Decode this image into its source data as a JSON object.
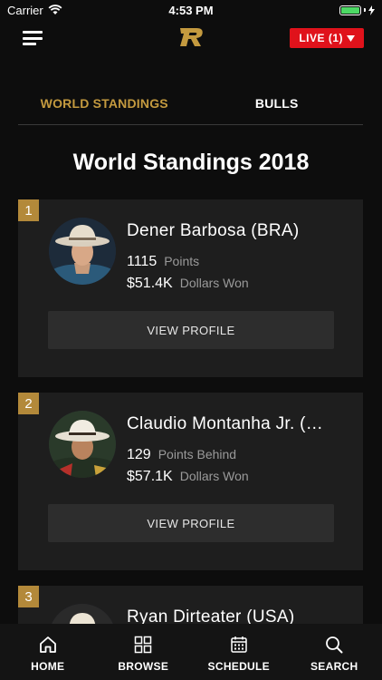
{
  "status_bar": {
    "carrier": "Carrier",
    "time": "4:53 PM"
  },
  "header": {
    "live_label": "LIVE (1)"
  },
  "tabs": [
    {
      "label": "WORLD STANDINGS",
      "active": true
    },
    {
      "label": "BULLS",
      "active": false
    }
  ],
  "section_title": "World Standings 2018",
  "riders": [
    {
      "rank": "1",
      "name": "Dener Barbosa (BRA)",
      "stat1_value": "1115",
      "stat1_label": "Points",
      "stat2_value": "$51.4K",
      "stat2_label": "Dollars Won",
      "button_label": "VIEW PROFILE"
    },
    {
      "rank": "2",
      "name": "Claudio Montanha Jr. (…",
      "stat1_value": "129",
      "stat1_label": "Points Behind",
      "stat2_value": "$57.1K",
      "stat2_label": "Dollars Won",
      "button_label": "VIEW PROFILE"
    },
    {
      "rank": "3",
      "name": "Ryan Dirteater (USA)"
    }
  ],
  "bottom_nav": [
    {
      "label": "HOME",
      "icon": "home-icon"
    },
    {
      "label": "BROWSE",
      "icon": "grid-icon"
    },
    {
      "label": "SCHEDULE",
      "icon": "calendar-icon"
    },
    {
      "label": "SEARCH",
      "icon": "search-icon"
    }
  ],
  "colors": {
    "accent_gold": "#c49a3f",
    "live_red": "#e0121b",
    "battery_green": "#4cd964"
  }
}
